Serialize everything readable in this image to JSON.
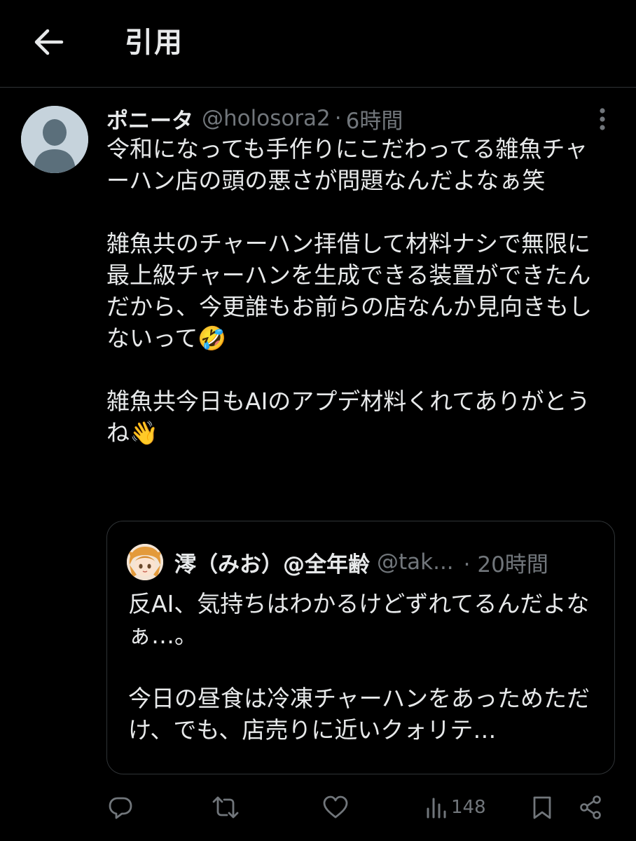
{
  "header": {
    "title": "引用",
    "back_icon": "arrow-left-icon"
  },
  "tweet": {
    "display_name": "ポニータ",
    "handle": "@holosora2",
    "separator": "·",
    "time": "6時間",
    "text": "令和になっても手作りにこだわってる雑魚チャーハン店の頭の悪さが問題なんだよなぁ笑\n\n雑魚共のチャーハン拝借して材料ナシで無限に最上級チャーハンを生成できる装置ができたんだから、今更誰もお前らの店なんか見向きもしないって🤣\n\n雑魚共今日もAIのアプデ材料くれてありがとうね👋",
    "avatar_icon": "default-avatar-icon",
    "more_icon": "more-vertical-icon"
  },
  "quoted": {
    "display_name": "澪（みお）@全年齢",
    "handle": "@tak...",
    "separator": "·",
    "time": "20時間",
    "text": "反AI、気持ちはわかるけどずれてるんだよなぁ…。\n\n今日の昼食は冷凍チャーハンをあっためただけ、でも、店売りに近いクォリテ…"
  },
  "actions": {
    "reply_icon": "reply-icon",
    "retweet_icon": "retweet-icon",
    "like_icon": "heart-icon",
    "views_icon": "views-icon",
    "views_count": "148",
    "bookmark_icon": "bookmark-icon",
    "share_icon": "share-icon"
  },
  "colors": {
    "background": "#000000",
    "text": "#e7e9ea",
    "secondary": "#71767b",
    "border": "#2f3336"
  }
}
